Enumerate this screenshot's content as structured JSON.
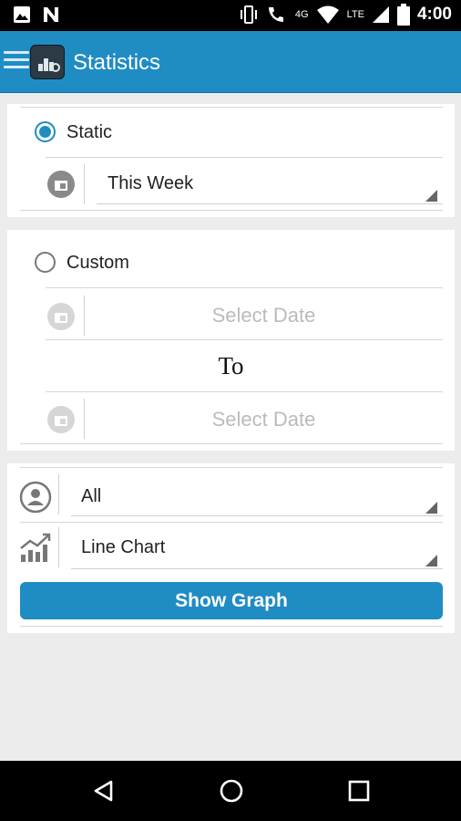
{
  "status_bar": {
    "time": "4:00",
    "network_label": "4G",
    "lte_label": "LTE"
  },
  "app_bar": {
    "title": "Statistics"
  },
  "static_section": {
    "radio_label": "Static",
    "selected": true,
    "period_value": "This Week"
  },
  "custom_section": {
    "radio_label": "Custom",
    "selected": false,
    "from_placeholder": "Select Date",
    "to_label": "To",
    "to_placeholder": "Select Date"
  },
  "filters": {
    "user_value": "All",
    "chart_type_value": "Line Chart",
    "show_graph_label": "Show Graph"
  },
  "colors": {
    "accent": "#1f8cc4",
    "status_bar": "#000000",
    "background": "#ececec"
  }
}
